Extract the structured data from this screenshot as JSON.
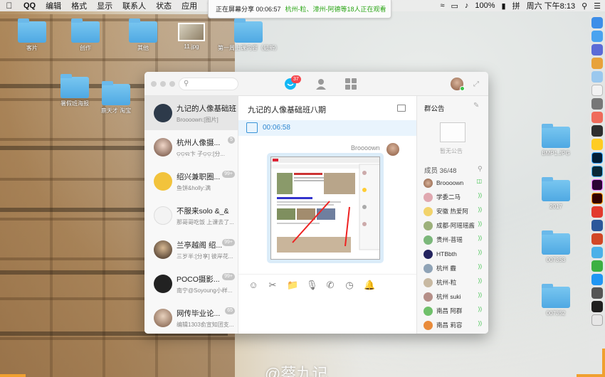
{
  "menubar": {
    "app_name": "QQ",
    "items": [
      "编辑",
      "格式",
      "显示",
      "联系人",
      "状态",
      "应用",
      "窗口",
      "帮"
    ],
    "battery": "100%",
    "clock": "周六 下午8:13",
    "input_method": "拼"
  },
  "share_banner": {
    "status": "正在屏幕分享 00:06:57",
    "viewers": "杭州-粒、漳州-阿德等18人正在观看"
  },
  "desktop_icons": [
    {
      "label": "客片"
    },
    {
      "label": "创作"
    },
    {
      "label": "其他"
    },
    {
      "label": "11.jpg"
    },
    {
      "label": "第一周上课内容（最新）"
    },
    {
      "label": "暑假班海报"
    },
    {
      "label": "鹿天才 淘宝"
    },
    {
      "label": "BMP1.JPG"
    },
    {
      "label": "2017"
    },
    {
      "label": "007353"
    },
    {
      "label": "007352"
    }
  ],
  "qq": {
    "search_placeholder": "",
    "message_badge": "37",
    "conversations": [
      {
        "name": "九记的人像基础班...",
        "preview": "Broooown:[图片]",
        "count": ""
      },
      {
        "name": "杭州人像摄...",
        "preview": "ଡ଼ଡ଼ଲ卞 子ଡ଼ଡ଼:[分...",
        "count": "5"
      },
      {
        "name": "绍兴兼职圈...",
        "preview": "鱼饼&holly:满",
        "count": "99+"
      },
      {
        "name": "不服来solo &_&",
        "preview": "那哥哥吃饭 上课去了...",
        "count": ""
      },
      {
        "name": "兰亭越阁 绍...",
        "preview": "三岁半:[分享] 彼岸花...",
        "count": "99+"
      },
      {
        "name": "POCO摄影...",
        "preview": "南宁@Soyoung小样...",
        "count": "99+"
      },
      {
        "name": "网传毕业论...",
        "preview": "编辑1303俞宣知团支...",
        "count": "65"
      }
    ],
    "chat": {
      "title": "九记的人像基础班八期",
      "share_time": "00:06:58",
      "sender": "Broooown"
    },
    "panel": {
      "notice_title": "群公告",
      "notice_empty": "暂无公告",
      "member_count": "成员 36/48",
      "members": [
        {
          "name": "Broooown"
        },
        {
          "name": "学委二马"
        },
        {
          "name": "安徽 热爱阿"
        },
        {
          "name": "成都-阿瑶瑶酱"
        },
        {
          "name": "贵州-菩瑶"
        },
        {
          "name": "HTBbth"
        },
        {
          "name": "杭州 霾"
        },
        {
          "name": "杭州-粒"
        },
        {
          "name": "杭州 suki"
        },
        {
          "name": "南昌 阿群"
        },
        {
          "name": "南昌 莉容"
        }
      ]
    }
  },
  "watermark": "@蔡九记"
}
